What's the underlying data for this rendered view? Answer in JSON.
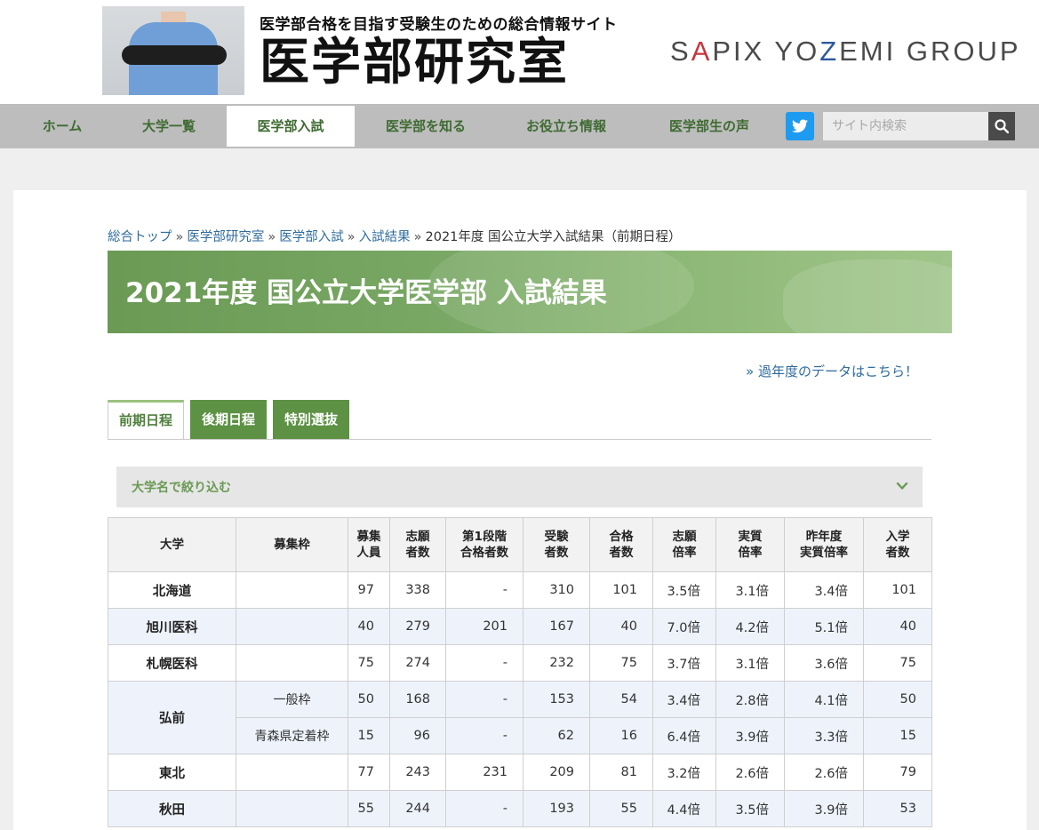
{
  "header": {
    "tagline": "医学部合格を目指す受験生のための総合情報サイト",
    "site_title": "医学部研究室",
    "group_logo": {
      "p1": "S",
      "p2": "A",
      "p3": "PIX YO",
      "p4": "Z",
      "p5": "EMI GROUP"
    }
  },
  "nav": {
    "items": [
      "ホーム",
      "大学一覧",
      "医学部入試",
      "医学部を知る",
      "お役立ち情報",
      "医学部生の声"
    ],
    "active_index": 2
  },
  "search": {
    "placeholder": "サイト内検索"
  },
  "breadcrumb": {
    "links": [
      "総合トップ",
      "医学部研究室",
      "医学部入試",
      "入試結果"
    ],
    "separator": "»",
    "current": "2021年度 国公立大学入試結果（前期日程）"
  },
  "page_title": "2021年度 国公立大学医学部 入試結果",
  "past_link": "» 過年度のデータはこちら！",
  "tabs": [
    "前期日程",
    "後期日程",
    "特別選抜"
  ],
  "filter": {
    "label": "大学名で絞り込む"
  },
  "colors": {
    "accent_green": "#5d9144",
    "link_blue": "#2e6b9e",
    "row_alt": "#eef3fb",
    "twitter": "#1d9bf0"
  },
  "table": {
    "headers": [
      [
        "大学"
      ],
      [
        "募集枠"
      ],
      [
        "募集",
        "人員"
      ],
      [
        "志願",
        "者数"
      ],
      [
        "第1段階",
        "合格者数"
      ],
      [
        "受験",
        "者数"
      ],
      [
        "合格",
        "者数"
      ],
      [
        "志願",
        "倍率"
      ],
      [
        "実質",
        "倍率"
      ],
      [
        "昨年度",
        "実質倍率"
      ],
      [
        "入学",
        "者数"
      ]
    ],
    "rows": [
      {
        "uni": "北海道",
        "quota": "",
        "v": [
          "97",
          "338",
          "-",
          "310",
          "101",
          "3.5倍",
          "3.1倍",
          "3.4倍",
          "101"
        ]
      },
      {
        "uni": "旭川医科",
        "quota": "",
        "v": [
          "40",
          "279",
          "201",
          "167",
          "40",
          "7.0倍",
          "4.2倍",
          "5.1倍",
          "40"
        ]
      },
      {
        "uni": "札幌医科",
        "quota": "",
        "v": [
          "75",
          "274",
          "-",
          "232",
          "75",
          "3.7倍",
          "3.1倍",
          "3.6倍",
          "75"
        ]
      },
      {
        "uni": "弘前",
        "quota": "一般枠",
        "v": [
          "50",
          "168",
          "-",
          "153",
          "54",
          "3.4倍",
          "2.8倍",
          "4.1倍",
          "50"
        ]
      },
      {
        "uni": "",
        "quota": "青森県定着枠",
        "v": [
          "15",
          "96",
          "-",
          "62",
          "16",
          "6.4倍",
          "3.9倍",
          "3.3倍",
          "15"
        ]
      },
      {
        "uni": "東北",
        "quota": "",
        "v": [
          "77",
          "243",
          "231",
          "209",
          "81",
          "3.2倍",
          "2.6倍",
          "2.6倍",
          "79"
        ]
      },
      {
        "uni": "秋田",
        "quota": "",
        "v": [
          "55",
          "244",
          "-",
          "193",
          "55",
          "4.4倍",
          "3.5倍",
          "3.9倍",
          "53"
        ]
      }
    ]
  }
}
